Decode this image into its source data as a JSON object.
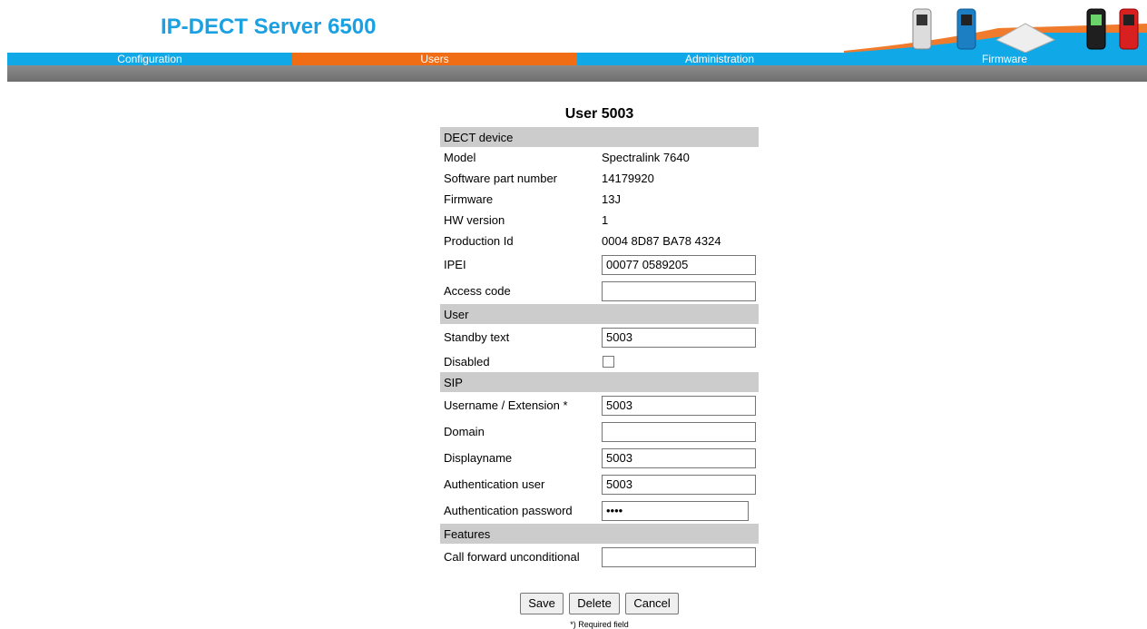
{
  "header": {
    "title": "IP-DECT Server 6500"
  },
  "nav": [
    {
      "label": "Configuration",
      "active": false
    },
    {
      "label": "Users",
      "active": true
    },
    {
      "label": "Administration",
      "active": false
    },
    {
      "label": "Firmware",
      "active": false
    }
  ],
  "page": {
    "title": "User 5003"
  },
  "sections": {
    "dect": "DECT device",
    "user": "User",
    "sip": "SIP",
    "features": "Features"
  },
  "dect": {
    "model_label": "Model",
    "model": "Spectralink 7640",
    "swpart_label": "Software part number",
    "swpart": "14179920",
    "firmware_label": "Firmware",
    "firmware": "13J",
    "hw_label": "HW version",
    "hw": "1",
    "prodid_label": "Production Id",
    "prodid": "0004 8D87 BA78 4324",
    "ipei_label": "IPEI",
    "ipei": "00077 0589205",
    "access_label": "Access code",
    "access": ""
  },
  "user": {
    "standby_label": "Standby text",
    "standby": "5003",
    "disabled_label": "Disabled",
    "disabled": false
  },
  "sip": {
    "username_label": "Username / Extension *",
    "username": "5003",
    "domain_label": "Domain",
    "domain": "",
    "display_label": "Displayname",
    "display": "5003",
    "authuser_label": "Authentication user",
    "authuser": "5003",
    "authpw_label": "Authentication password",
    "authpw": "••••"
  },
  "features": {
    "cfu_label": "Call forward unconditional",
    "cfu": ""
  },
  "buttons": {
    "save": "Save",
    "delete": "Delete",
    "cancel": "Cancel"
  },
  "footnote": "*) Required field",
  "colors": {
    "brand": "#1ba1e2",
    "nav": "#10a8e6",
    "nav_active": "#f06d15",
    "section": "#cccccc"
  }
}
